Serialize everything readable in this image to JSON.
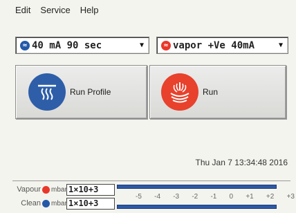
{
  "menu": {
    "items": [
      "Edit",
      "Service",
      "Help"
    ]
  },
  "profile_select": {
    "value": "40 mA 90 sec",
    "icon": "blue-circle-icon"
  },
  "mode_select": {
    "value": "vapor +Ve 40mA",
    "icon": "red-circle-icon"
  },
  "buttons": {
    "run_profile": {
      "label": "Run Profile",
      "icon": "clean-heat-icon",
      "color": "#2e5ea8"
    },
    "run": {
      "label": "Run",
      "icon": "vapor-flower-icon",
      "color": "#e8412c"
    }
  },
  "timestamp": "Thu Jan  7 13:34:48 2016",
  "gauges": {
    "vapour": {
      "label": "Vapour",
      "unit": "mbar",
      "value": "1×10+3"
    },
    "clean": {
      "label": "Clean",
      "unit": "mbar",
      "value": "1×10+3"
    },
    "scale": [
      "-5",
      "-4",
      "-3",
      "-2",
      "-1",
      "0",
      "+1",
      "+2",
      "+3"
    ]
  }
}
